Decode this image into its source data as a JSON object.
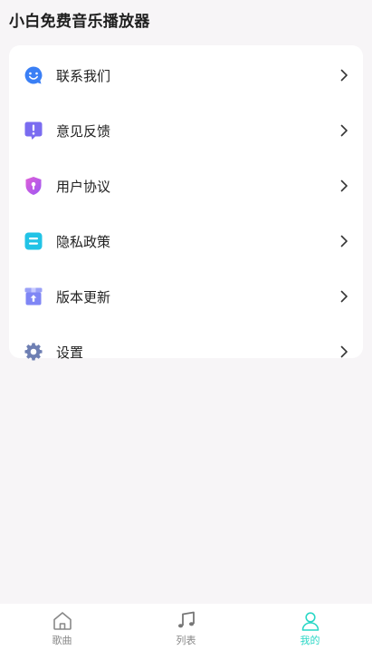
{
  "header": {
    "title": "小白免费音乐播放器"
  },
  "menu": {
    "items": [
      {
        "label": "联系我们",
        "icon": "chat-smile-icon",
        "color": "#3a7ff5"
      },
      {
        "label": "意见反馈",
        "icon": "feedback-exclamation-icon",
        "color": "#7a6cf0"
      },
      {
        "label": "用户协议",
        "icon": "shield-lock-icon",
        "color": "#c45bf0"
      },
      {
        "label": "隐私政策",
        "icon": "document-lines-icon",
        "color": "#22c3e6"
      },
      {
        "label": "版本更新",
        "icon": "box-upload-icon",
        "color": "#7f86f5"
      },
      {
        "label": "设置",
        "icon": "gear-icon",
        "color": "#6e7fb3"
      }
    ]
  },
  "tabbar": {
    "active_color": "#2ad7c6",
    "inactive_color": "#888888",
    "tabs": [
      {
        "label": "歌曲",
        "icon": "home-icon",
        "active": false
      },
      {
        "label": "列表",
        "icon": "music-note-icon",
        "active": false
      },
      {
        "label": "我的",
        "icon": "user-icon",
        "active": true
      }
    ]
  }
}
